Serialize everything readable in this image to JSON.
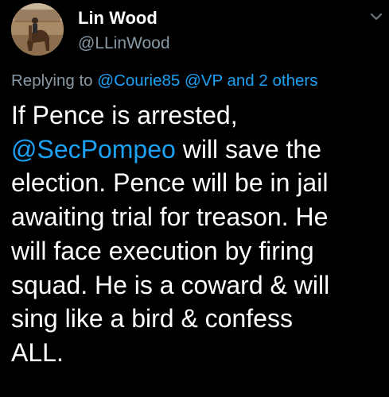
{
  "user": {
    "display_name": "Lin Wood",
    "handle": "@LLinWood"
  },
  "reply": {
    "prefix": "Replying to",
    "mention_1": "@Courie85",
    "mention_2": "@VP",
    "conjunction": "and",
    "others": "2 others"
  },
  "tweet": {
    "line1": "If Pence is arrested,",
    "mention": "@SecPompeo",
    "line2_rest": " will save the",
    "line3": "election. Pence will be in jail",
    "line4": "awaiting trial for treason. He",
    "line5": "will face execution by firing",
    "line6": "squad. He is a coward & will",
    "line7": "sing like a bird & confess",
    "line8": "ALL."
  },
  "icons": {
    "avatar": "avatar",
    "menu": "chevron-down-icon"
  },
  "colors": {
    "background": "#000000",
    "text": "#ffffff",
    "secondary": "#8899a6",
    "link": "#1da1f2"
  }
}
